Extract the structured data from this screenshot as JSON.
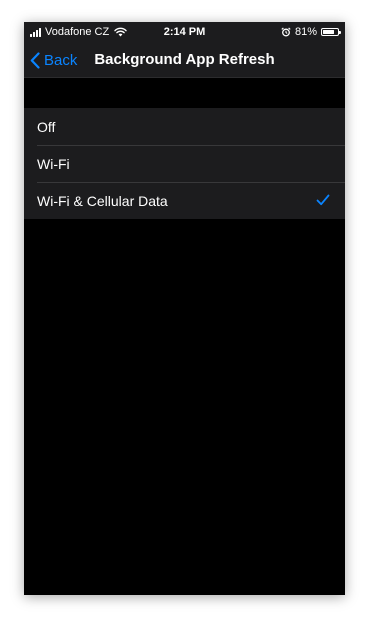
{
  "status_bar": {
    "carrier": "Vodafone CZ",
    "time": "2:14 PM",
    "battery_percent": "81%",
    "battery_level": 0.81,
    "icons": [
      "signal-icon",
      "wifi-icon",
      "alarm-icon",
      "battery-icon"
    ]
  },
  "nav": {
    "back_label": "Back",
    "title": "Background App Refresh",
    "back_icon": "chevron-left-icon"
  },
  "options": [
    {
      "label": "Off",
      "selected": false
    },
    {
      "label": "Wi-Fi",
      "selected": false
    },
    {
      "label": "Wi-Fi & Cellular Data",
      "selected": true
    }
  ],
  "colors": {
    "accent": "#0a84ff",
    "background": "#000000",
    "cell_background": "#1c1c1e",
    "text": "#ffffff"
  }
}
